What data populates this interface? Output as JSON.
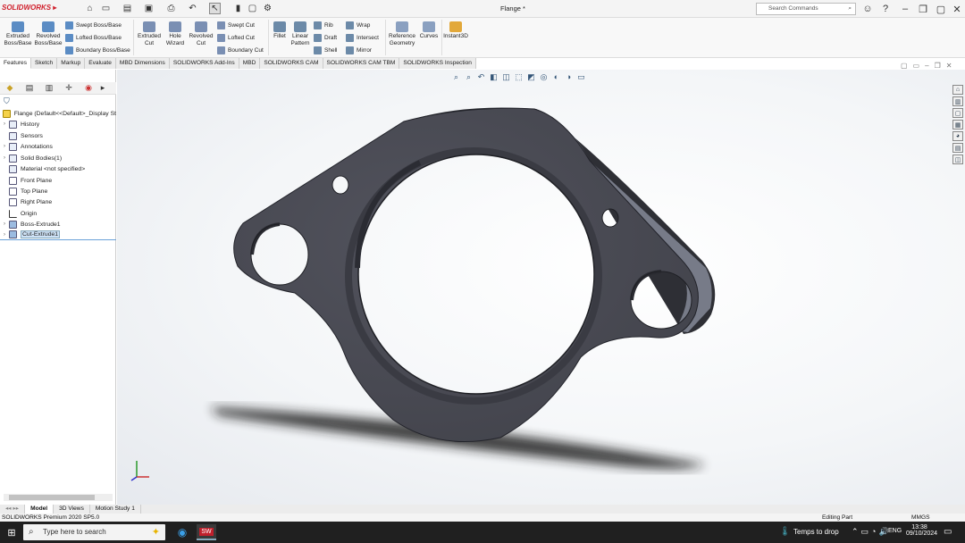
{
  "app": {
    "logo": "SOLIDWORKS",
    "doc_title": "Flange *"
  },
  "search": {
    "placeholder": "Search Commands"
  },
  "ribbon": {
    "extruded_boss": "Extruded Boss/Base",
    "revolved_boss": "Revolved Boss/Base",
    "swept_boss": "Swept Boss/Base",
    "lofted_boss": "Lofted Boss/Base",
    "boundary_boss": "Boundary Boss/Base",
    "extruded_cut": "Extruded Cut",
    "hole_wizard": "Hole Wizard",
    "revolved_cut": "Revolved Cut",
    "swept_cut": "Swept Cut",
    "lofted_cut": "Lofted Cut",
    "boundary_cut": "Boundary Cut",
    "fillet": "Fillet",
    "linear_pattern": "Linear Pattern",
    "rib": "Rib",
    "draft": "Draft",
    "shell": "Shell",
    "wrap": "Wrap",
    "intersect": "Intersect",
    "mirror": "Mirror",
    "reference_geometry": "Reference Geometry",
    "curves": "Curves",
    "instant3d": "Instant3D"
  },
  "tabs": [
    "Features",
    "Sketch",
    "Markup",
    "Evaluate",
    "MBD Dimensions",
    "SOLIDWORKS Add-Ins",
    "MBD",
    "SOLIDWORKS CAM",
    "SOLIDWORKS CAM TBM",
    "SOLIDWORKS Inspection"
  ],
  "tree": {
    "root": "Flange  (Default<<Default>_Display St",
    "items": [
      "History",
      "Sensors",
      "Annotations",
      "Solid Bodies(1)",
      "Material <not specified>",
      "Front Plane",
      "Top Plane",
      "Right Plane",
      "Origin",
      "Boss-Extrude1",
      "Cut-Extrude1"
    ]
  },
  "bottom_tabs": [
    "Model",
    "3D Views",
    "Motion Study 1"
  ],
  "status": {
    "version": "SOLIDWORKS Premium 2020 SP5.0",
    "mode": "Editing Part",
    "units": "MMGS"
  },
  "taskbar": {
    "search": "Type here to search",
    "weather": "Temps to drop",
    "lang": "ENG",
    "time": "13:38",
    "date": "09/10/2024"
  },
  "colors": {
    "part": "#4a4b55",
    "brand": "#d0202c"
  }
}
